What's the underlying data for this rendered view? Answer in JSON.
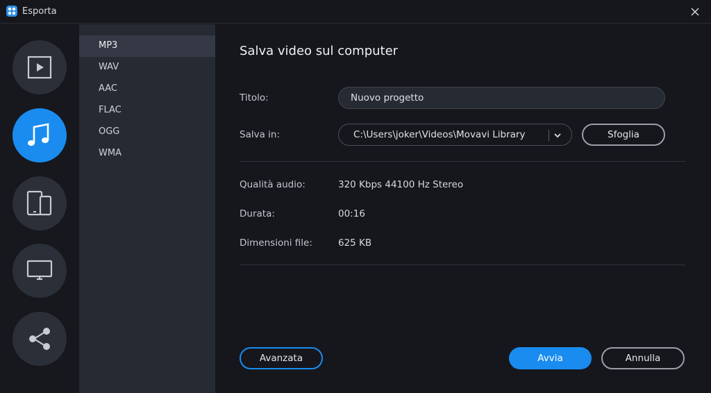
{
  "window": {
    "title": "Esporta",
    "accent_color": "#1a8cf0"
  },
  "left_rail": {
    "items": [
      {
        "icon": "video-icon",
        "active": false
      },
      {
        "icon": "music-note-icon",
        "active": true
      },
      {
        "icon": "devices-icon",
        "active": false
      },
      {
        "icon": "monitor-icon",
        "active": false
      },
      {
        "icon": "share-icon",
        "active": false
      }
    ]
  },
  "formats": {
    "items": [
      "MP3",
      "WAV",
      "AAC",
      "FLAC",
      "OGG",
      "WMA"
    ],
    "selected": "MP3"
  },
  "main": {
    "heading": "Salva video sul computer",
    "title_label": "Titolo:",
    "title_value": "Nuovo progetto",
    "save_in_label": "Salva in:",
    "save_in_value": "C:\\Users\\joker\\Videos\\Movavi Library",
    "browse_label": "Sfoglia",
    "quality_label": "Qualità audio:",
    "quality_value": "320 Kbps 44100 Hz Stereo",
    "duration_label": "Durata:",
    "duration_value": "00:16",
    "size_label": "Dimensioni file:",
    "size_value": "625 KB"
  },
  "footer": {
    "advanced_label": "Avanzata",
    "start_label": "Avvia",
    "cancel_label": "Annulla"
  }
}
